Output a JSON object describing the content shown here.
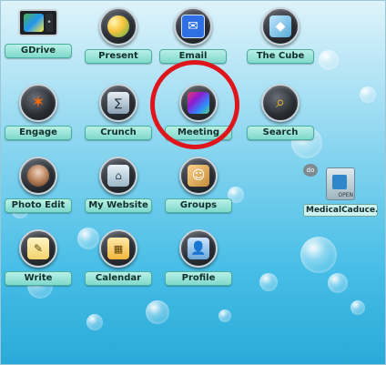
{
  "desktop": {
    "apps": [
      {
        "key": "gdrive",
        "label": "GDrive",
        "icon": "drive-icon",
        "color": "#4caf50"
      },
      {
        "key": "present",
        "label": "Present",
        "icon": "presentation-icon",
        "color": "#f5c33b"
      },
      {
        "key": "email",
        "label": "Email",
        "icon": "email-icon",
        "color": "#2f6fe4"
      },
      {
        "key": "the_cube",
        "label": "The Cube",
        "icon": "cube-icon",
        "color": "#59a9d6"
      },
      {
        "key": "engage",
        "label": "Engage",
        "icon": "spark-icon",
        "color": "#ff6b00"
      },
      {
        "key": "crunch",
        "label": "Crunch",
        "icon": "calculator-icon",
        "color": "#8aa1b5"
      },
      {
        "key": "meeting",
        "label": "Meeting",
        "icon": "meeting-icon",
        "color": "#e23d6c"
      },
      {
        "key": "search",
        "label": "Search",
        "icon": "search-icon",
        "color": "#e9b12b"
      },
      {
        "key": "photo_edit",
        "label": "Photo Edit",
        "icon": "photo-icon",
        "color": "#b07a53"
      },
      {
        "key": "my_website",
        "label": "My Website",
        "icon": "web-icon",
        "color": "#9db7c8"
      },
      {
        "key": "groups",
        "label": "Groups",
        "icon": "groups-icon",
        "color": "#c18b3a"
      },
      {
        "key": "write",
        "label": "Write",
        "icon": "write-icon",
        "color": "#f2d36b"
      },
      {
        "key": "calendar",
        "label": "Calendar",
        "icon": "calendar-icon",
        "color": "#f0b63a"
      },
      {
        "key": "profile",
        "label": "Profile",
        "icon": "profile-icon",
        "color": "#6aa6d8"
      }
    ],
    "file": {
      "label": "MedicalCaduce...",
      "badge": "do",
      "open_text": "OPEN"
    }
  },
  "colors": {
    "annotation_circle": "#e0141b",
    "label_bg": "#8fe2d4",
    "desktop_bg": "#45bde6"
  }
}
